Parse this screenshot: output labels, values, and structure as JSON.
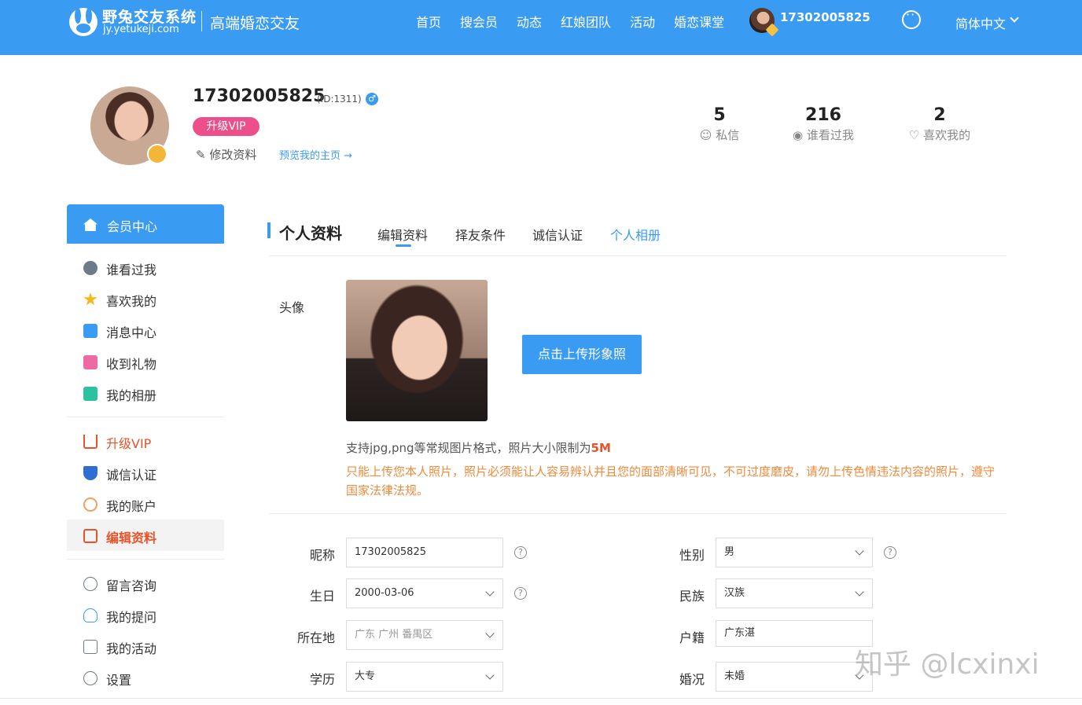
{
  "header": {
    "logo_text": "野兔交友系统",
    "logo_domain": "jy.yetukeji.com",
    "slogan": "高端婚恋交友",
    "nav": [
      "首页",
      "搜会员",
      "动态",
      "红娘团队",
      "活动",
      "婚恋课堂"
    ],
    "user": "17302005825",
    "language": "简体中文"
  },
  "profile": {
    "username": "17302005825",
    "id_text": "(ID:1311)",
    "gender_symbol": "♂",
    "vip_button": "升级VIP",
    "edit_link": "修改资料",
    "preview_link": "预览我的主页 →",
    "stats": [
      {
        "num": "5",
        "label": "私信"
      },
      {
        "num": "216",
        "label": "谁看过我"
      },
      {
        "num": "2",
        "label": "喜欢我的"
      }
    ]
  },
  "sidebar": {
    "header": "会员中心",
    "items": [
      {
        "label": "谁看过我",
        "color": "#6c7a89"
      },
      {
        "label": "喜欢我的",
        "color": "#f5b719"
      },
      {
        "label": "消息中心",
        "color": "#3a9bf2"
      },
      {
        "label": "收到礼物",
        "color": "#ef6aa0"
      },
      {
        "label": "我的相册",
        "color": "#2ec1a0"
      },
      {
        "label": "升级VIP",
        "color": "#e8542a"
      },
      {
        "label": "诚信认证",
        "color": "#2e6fd1"
      },
      {
        "label": "我的账户",
        "color": "#f0a060"
      },
      {
        "label": "编辑资料",
        "color": "#e8542a"
      },
      {
        "label": "留言咨询",
        "color": "#6c7a89"
      },
      {
        "label": "我的提问",
        "color": "#3a9bf2"
      },
      {
        "label": "我的活动",
        "color": "#6c7a89"
      },
      {
        "label": "设置",
        "color": "#6c7a89"
      }
    ]
  },
  "main": {
    "title": "个人资料",
    "tabs": [
      "编辑资料",
      "择友条件",
      "诚信认证",
      "个人相册"
    ],
    "avatar_label": "头像",
    "upload_button": "点击上传形象照",
    "hint_main": "支持jpg,png等常规图片格式，照片大小限制为",
    "hint_size": "5M",
    "hint_warning": "只能上传您本人照片，照片必须能让人容易辨认并且您的面部清晰可见，不可过度磨皮，请勿上传色情违法内容的照片，遵守国家法律法规。",
    "fields": {
      "nickname": {
        "label": "昵称",
        "value": "17302005825"
      },
      "gender": {
        "label": "性别",
        "value": "男"
      },
      "birthday": {
        "label": "生日",
        "value": "2000-03-06"
      },
      "ethnicity": {
        "label": "民族",
        "value": "汉族"
      },
      "location": {
        "label": "所在地",
        "value": "广东 广州 番禺区"
      },
      "hometown": {
        "label": "户籍",
        "value": "广东湛"
      },
      "education": {
        "label": "学历",
        "value": "大专"
      },
      "marital": {
        "label": "婚况",
        "value": "未婚"
      }
    }
  },
  "watermark": "知乎 @lcxinxi"
}
